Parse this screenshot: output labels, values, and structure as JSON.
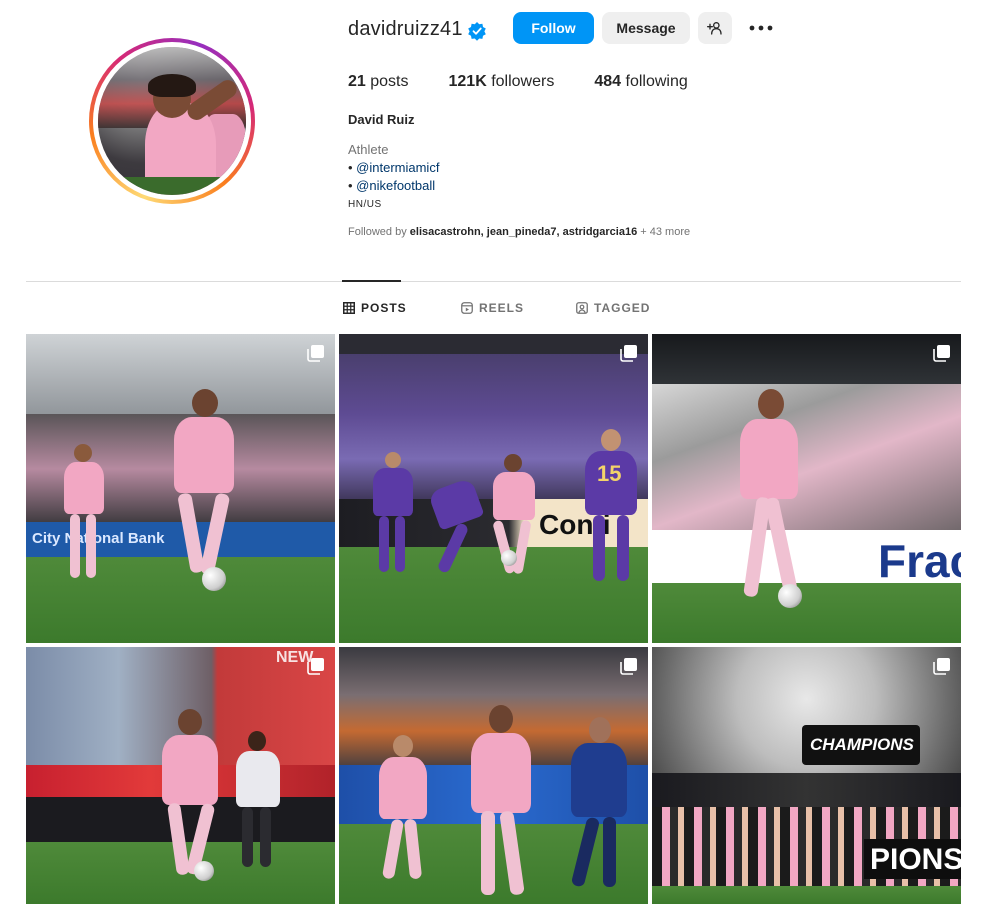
{
  "profile": {
    "username": "davidruizz41",
    "verified": true,
    "follow_label": "Follow",
    "message_label": "Message",
    "posts_count": "21",
    "posts_label": "posts",
    "followers_count": "121K",
    "followers_label": "followers",
    "following_count": "484",
    "following_label": "following",
    "full_name": "David Ruiz",
    "category": "Athlete",
    "bio": {
      "line1_bullet": "• ",
      "line1_link": "@intermiamicf",
      "line2_bullet": "• ",
      "line2_link": "@nikefootball",
      "country": "HN/US"
    },
    "followed_by": {
      "prefix": "Followed by ",
      "names": "elisacastrohn, jean_pineda7, astridgarcia16",
      "suffix": " + 43 more"
    }
  },
  "tabs": [
    {
      "label": "POSTS",
      "icon": "grid-icon",
      "active": true
    },
    {
      "label": "REELS",
      "icon": "reels-icon",
      "active": false
    },
    {
      "label": "TAGGED",
      "icon": "tagged-icon",
      "active": false
    }
  ],
  "posts": [
    {
      "icon": "carousel-icon",
      "board": "City National Bank"
    },
    {
      "icon": "carousel-icon",
      "board": "Conti",
      "number": "15"
    },
    {
      "icon": "carousel-icon",
      "board": "Frac"
    },
    {
      "icon": "carousel-icon",
      "board": "NEW"
    },
    {
      "icon": "carousel-icon"
    },
    {
      "icon": "carousel-icon",
      "board": "CHAMPIONS",
      "board2": "PIONS"
    }
  ],
  "colors": {
    "accent_blue": "#0095f6",
    "verified_blue": "#0095f6",
    "link": "#00376b",
    "inter_miami_pink": "#f2a7c3"
  }
}
